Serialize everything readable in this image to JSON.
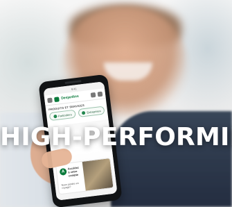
{
  "image": {
    "headline": "HIGH-PERFORMING",
    "phone": {
      "status_text": "9:41",
      "brand_name": "Desjardins",
      "section_title": "PRODUITS ET SERVICES",
      "pills": [
        {
          "label": "Particuliers"
        },
        {
          "label": "Entreprises"
        }
      ],
      "promo": {
        "badge": "A",
        "title": "Accédez à votre compte",
        "subtitle": "Nous joindre en voyage?"
      }
    },
    "colors": {
      "brand_green": "#0a7a3b",
      "headline": "#ffffff"
    }
  }
}
